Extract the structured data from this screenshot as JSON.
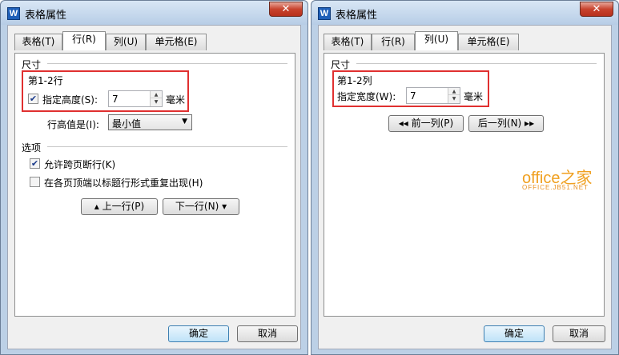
{
  "left": {
    "title": "表格属性",
    "close_label": "✕",
    "tabs": [
      {
        "label": "表格(T)"
      },
      {
        "label": "行(R)"
      },
      {
        "label": "列(U)"
      },
      {
        "label": "单元格(E)"
      }
    ],
    "active_tab": "行(R)",
    "size_section": "尺寸",
    "rows_label": "第1-2行",
    "specify_height": {
      "label": "指定高度(S):",
      "checked": true,
      "value": "7",
      "unit": "毫米"
    },
    "row_height_is": {
      "label": "行高值是(I):",
      "selected": "最小值"
    },
    "options_section": "选项",
    "allow_break": {
      "label": "允许跨页断行(K)",
      "checked": true
    },
    "repeat_header": {
      "label": "在各页顶端以标题行形式重复出现(H)",
      "checked": false
    },
    "prev_row": "上一行(P)",
    "next_row": "下一行(N)",
    "ok": "确定",
    "cancel": "取消"
  },
  "right": {
    "title": "表格属性",
    "close_label": "✕",
    "tabs": [
      {
        "label": "表格(T)"
      },
      {
        "label": "行(R)"
      },
      {
        "label": "列(U)"
      },
      {
        "label": "单元格(E)"
      }
    ],
    "active_tab": "列(U)",
    "size_section": "尺寸",
    "cols_label": "第1-2列",
    "specify_width": {
      "label": "指定宽度(W):",
      "value": "7",
      "unit": "毫米"
    },
    "prev_col": "前一列(P)",
    "next_col": "后一列(N)",
    "ok": "确定",
    "cancel": "取消"
  },
  "watermark": {
    "main": "office之家",
    "sub": "OFFICE.JB51.NET"
  },
  "colors": {
    "highlight_box": "#e03030",
    "watermark": "#f0a020"
  }
}
